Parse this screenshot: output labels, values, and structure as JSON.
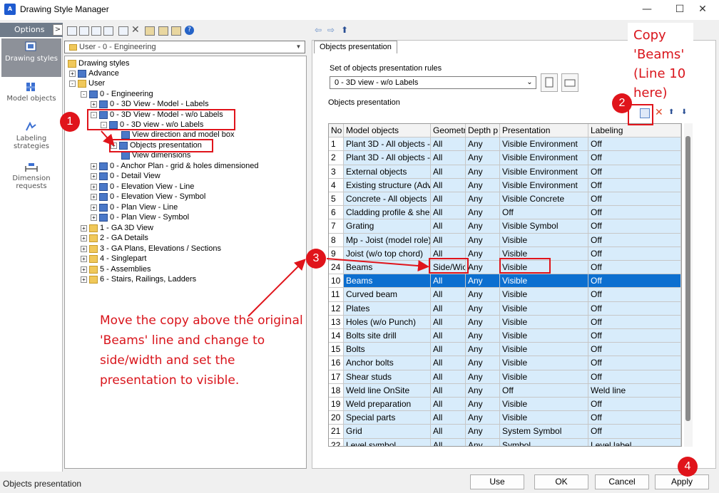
{
  "window": {
    "title": "Drawing Style Manager",
    "app_icon_text": "A",
    "minimize": "—",
    "maximize": "☐",
    "close": "✕"
  },
  "options": {
    "label": "Options",
    "arrow": ">",
    "nav": [
      {
        "label": "Drawing styles",
        "icon": "drawing-styles-icon",
        "selected": true
      },
      {
        "label": "Model objects",
        "icon": "model-objects-icon",
        "selected": false
      },
      {
        "label": "Labeling strategies",
        "icon": "labeling-icon",
        "selected": false
      },
      {
        "label": "Dimension requests",
        "icon": "dimension-icon",
        "selected": false
      }
    ]
  },
  "top_combo": {
    "value": "User - 0 - Engineering"
  },
  "tree": [
    {
      "label": "Drawing styles",
      "icon": "folder",
      "exp": ""
    },
    {
      "label": "Advance",
      "icon": "style",
      "exp": "+"
    },
    {
      "label": "User",
      "icon": "folder",
      "exp": "-"
    },
    {
      "label": "0 - Engineering",
      "icon": "style",
      "exp": "-"
    },
    {
      "label": "0 - 3D View - Model - Labels",
      "icon": "style",
      "exp": "+"
    },
    {
      "label": "0 - 3D View - Model - w/o Labels",
      "icon": "style",
      "exp": "-"
    },
    {
      "label": "0 - 3D view - w/o Labels",
      "icon": "style",
      "exp": "-"
    },
    {
      "label": "View direction and model box",
      "icon": "style",
      "exp": ""
    },
    {
      "label": "Objects presentation",
      "icon": "style",
      "exp": "+"
    },
    {
      "label": "View dimensions",
      "icon": "style",
      "exp": ""
    },
    {
      "label": "0 - Anchor Plan - grid & holes dimensioned",
      "icon": "style",
      "exp": "+"
    },
    {
      "label": "0 - Detail View",
      "icon": "style",
      "exp": "+"
    },
    {
      "label": "0 - Elevation View - Line",
      "icon": "style",
      "exp": "+"
    },
    {
      "label": "0 - Elevation View - Symbol",
      "icon": "style",
      "exp": "+"
    },
    {
      "label": "0 - Plan View - Line",
      "icon": "style",
      "exp": "+"
    },
    {
      "label": "0 - Plan View - Symbol",
      "icon": "style",
      "exp": "+"
    },
    {
      "label": "1 - GA 3D View",
      "icon": "folder",
      "exp": "+"
    },
    {
      "label": "2 - GA Details",
      "icon": "folder",
      "exp": "+"
    },
    {
      "label": "3 - GA Plans, Elevations / Sections",
      "icon": "folder",
      "exp": "+"
    },
    {
      "label": "4 - Singlepart",
      "icon": "folder",
      "exp": "+"
    },
    {
      "label": "5 - Assemblies",
      "icon": "folder",
      "exp": "+"
    },
    {
      "label": "6 - Stairs, Railings, Ladders",
      "icon": "folder",
      "exp": "+"
    }
  ],
  "right": {
    "tab": "Objects presentation",
    "rules_label": "Set of objects presentation rules",
    "rules_value": "0 - 3D view - w/o Labels",
    "section_label": "Objects presentation"
  },
  "table": {
    "headers": [
      "No",
      "Model objects",
      "Geometry",
      "Depth p",
      "Presentation",
      "Labeling"
    ],
    "rows": [
      [
        "1",
        "Plant 3D - All objects - ",
        "All",
        "Any",
        "Visible Environment",
        "Off"
      ],
      [
        "2",
        "Plant 3D - All objects - ",
        "All",
        "Any",
        "Visible Environment",
        "Off"
      ],
      [
        "3",
        "External objects",
        "All",
        "Any",
        "Visible Environment",
        "Off"
      ],
      [
        "4",
        "Existing structure (Adva",
        "All",
        "Any",
        "Visible Environment",
        "Off"
      ],
      [
        "5",
        "Concrete - All objects",
        "All",
        "Any",
        "Visible Concrete",
        "Off"
      ],
      [
        "6",
        "Cladding profile & she",
        "All",
        "Any",
        "Off",
        "Off"
      ],
      [
        "7",
        "Grating",
        "All",
        "Any",
        "Visible Symbol",
        "Off"
      ],
      [
        "8",
        "Mp - Joist (model role)",
        "All",
        "Any",
        "Visible",
        "Off"
      ],
      [
        "9",
        "Joist (w/o top chord)",
        "All",
        "Any",
        "Visible",
        "Off"
      ],
      [
        "24",
        "Beams",
        "Side/Wic",
        "Any",
        "Visible",
        "Off"
      ],
      [
        "10",
        "Beams",
        "All",
        "Any",
        "Visible",
        "Off"
      ],
      [
        "11",
        "Curved beam",
        "All",
        "Any",
        "Visible",
        "Off"
      ],
      [
        "12",
        "Plates",
        "All",
        "Any",
        "Visible",
        "Off"
      ],
      [
        "13",
        "Holes (w/o Punch)",
        "All",
        "Any",
        "Visible",
        "Off"
      ],
      [
        "14",
        "Bolts site drill",
        "All",
        "Any",
        "Visible",
        "Off"
      ],
      [
        "15",
        "Bolts",
        "All",
        "Any",
        "Visible",
        "Off"
      ],
      [
        "16",
        "Anchor bolts",
        "All",
        "Any",
        "Visible",
        "Off"
      ],
      [
        "17",
        "Shear studs",
        "All",
        "Any",
        "Visible",
        "Off"
      ],
      [
        "18",
        "Weld line OnSite",
        "All",
        "Any",
        "Off",
        "Weld line"
      ],
      [
        "19",
        "Weld preparation",
        "All",
        "Any",
        "Visible",
        "Off"
      ],
      [
        "20",
        "Special parts",
        "All",
        "Any",
        "Visible",
        "Off"
      ],
      [
        "21",
        "Grid",
        "All",
        "Any",
        "System Symbol",
        "Off"
      ],
      [
        "22",
        "Level symbol",
        "All",
        "Any",
        "Symbol",
        "Level label"
      ]
    ],
    "selected_index": 10
  },
  "buttons": {
    "use": "Use",
    "ok": "OK",
    "cancel": "Cancel",
    "apply": "Apply"
  },
  "status": "Objects presentation",
  "annotations": {
    "copy_note": "Copy 'Beams' (Line 10 here)",
    "instructions": "Move the copy above the original 'Beams' line and change to side/width and set the presentation to visible.",
    "badge1": "1",
    "badge2": "2",
    "badge3": "3",
    "badge4": "4",
    "color": "#e0141b"
  }
}
